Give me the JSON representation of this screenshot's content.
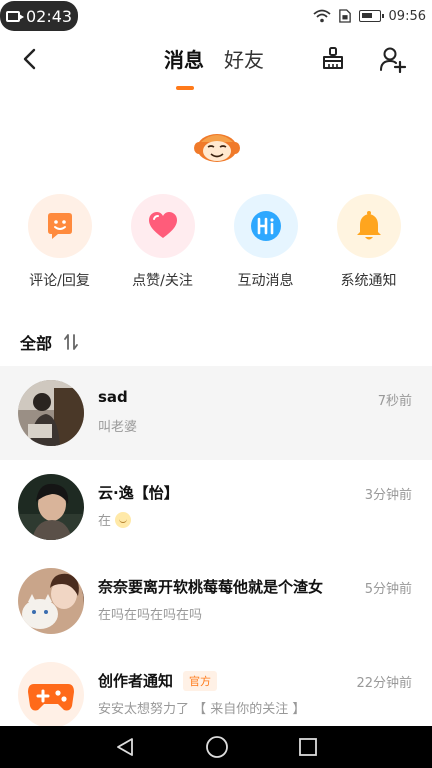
{
  "status_bar": {
    "recording_time": "02:43",
    "clock": "09:56"
  },
  "header": {
    "tabs": [
      {
        "label": "消息",
        "active": true
      },
      {
        "label": "好友",
        "active": false
      }
    ],
    "icons": [
      "back-icon",
      "broom-clean-icon",
      "add-friend-icon"
    ]
  },
  "quick_entries": [
    {
      "label": "评论/回复",
      "icon": "comment-icon",
      "color": "#ff8a3d",
      "bg": "#fff0e6"
    },
    {
      "label": "点赞/关注",
      "icon": "heart-icon",
      "color": "#ff5c7a",
      "bg": "#ffecef"
    },
    {
      "label": "互动消息",
      "icon": "hi-icon",
      "color": "#2ea8ff",
      "bg": "#e6f5ff"
    },
    {
      "label": "系统通知",
      "icon": "bell-icon",
      "color": "#ffa51e",
      "bg": "#fff4e0"
    }
  ],
  "section": {
    "title": "全部",
    "sort_icon": "sort-icon"
  },
  "messages": [
    {
      "name": "sad",
      "preview": "叫老婆",
      "time": "7秒前"
    },
    {
      "name": "云·逸【怡】",
      "preview": "在",
      "time": "3分钟前"
    },
    {
      "name": "奈奈要离开软桃莓莓他就是个渣女",
      "preview": "在吗在吗在吗在吗",
      "time": "5分钟前"
    },
    {
      "name": "创作者通知",
      "badge": "官方",
      "preview": "安安太想努力了 【 来自你的关注 】",
      "time": "22分钟前"
    }
  ],
  "colors": {
    "accent": "#ff7a1a"
  }
}
